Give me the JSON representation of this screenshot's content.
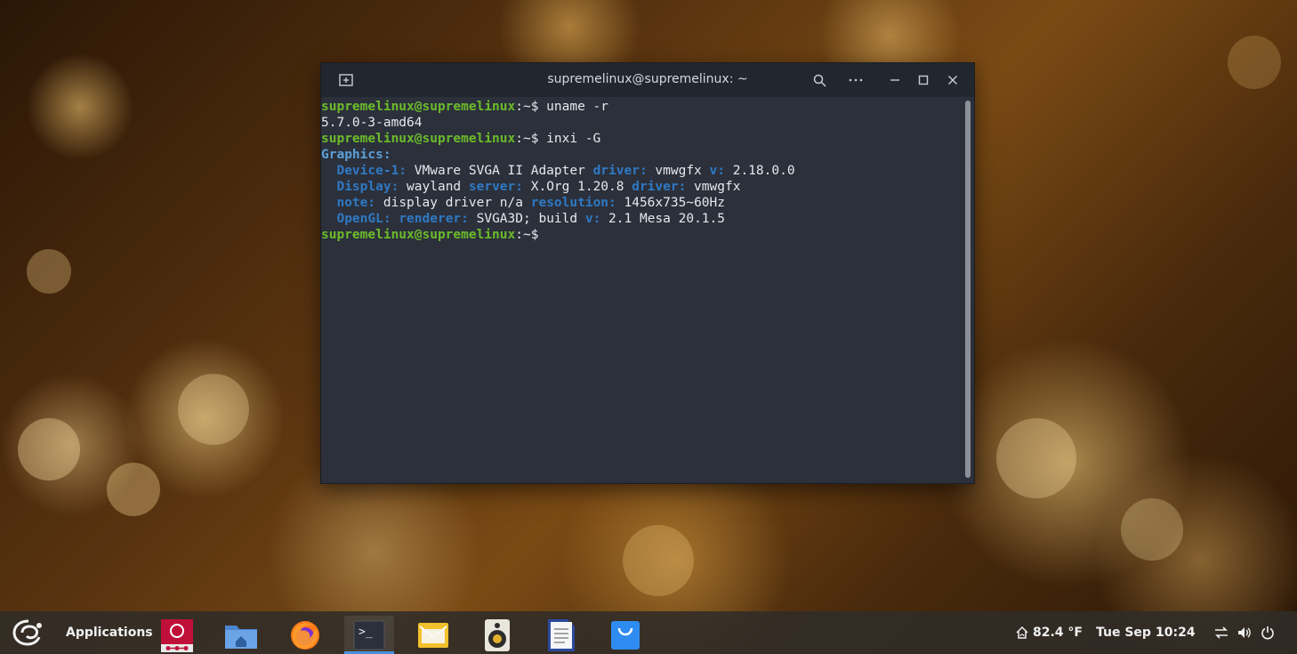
{
  "window": {
    "title": "supremelinux@supremelinux: ~",
    "user_host": "supremelinux@supremelinux",
    "path_prompt": ":~$ ",
    "lines": {
      "cmd1": "uname -r",
      "out1": "5.7.0-3-amd64",
      "cmd2": "inxi -G",
      "graphics_label": "Graphics:",
      "device_label": "Device-1:",
      "device_value": " VMware SVGA II Adapter ",
      "driver_label": "driver:",
      "driver_value": " vmwgfx ",
      "v_label": "v:",
      "v_value": " 2.18.0.0",
      "display_label": "Display:",
      "display_value": " wayland ",
      "server_label": "server:",
      "server_value": " X.Org 1.20.8 ",
      "driver2_label": "driver:",
      "driver2_value": " vmwgfx",
      "note_label": "note:",
      "note_value": " display driver n/a ",
      "resolution_label": "resolution:",
      "resolution_value": " 1456x735~60Hz",
      "opengl_label": "OpenGL:",
      "renderer_label": "renderer:",
      "renderer_value": " SVGA3D; build ",
      "v2_label": "v:",
      "v2_value": " 2.1 Mesa 20.1.5"
    }
  },
  "taskbar": {
    "applications_label": "Applications",
    "apps": [
      "debian-installer-icon",
      "files-icon",
      "firefox-icon",
      "terminal-icon",
      "mail-icon",
      "speaker-icon",
      "text-editor-icon",
      "software-store-icon"
    ],
    "weather": "82.4 °F",
    "date": "Tue Sep 1",
    "time": "10:24"
  },
  "colors": {
    "username": "#6cbb2a",
    "label": "#2f79c3",
    "terminal_bg": "#2b303b",
    "accent": "#4a90d9"
  }
}
